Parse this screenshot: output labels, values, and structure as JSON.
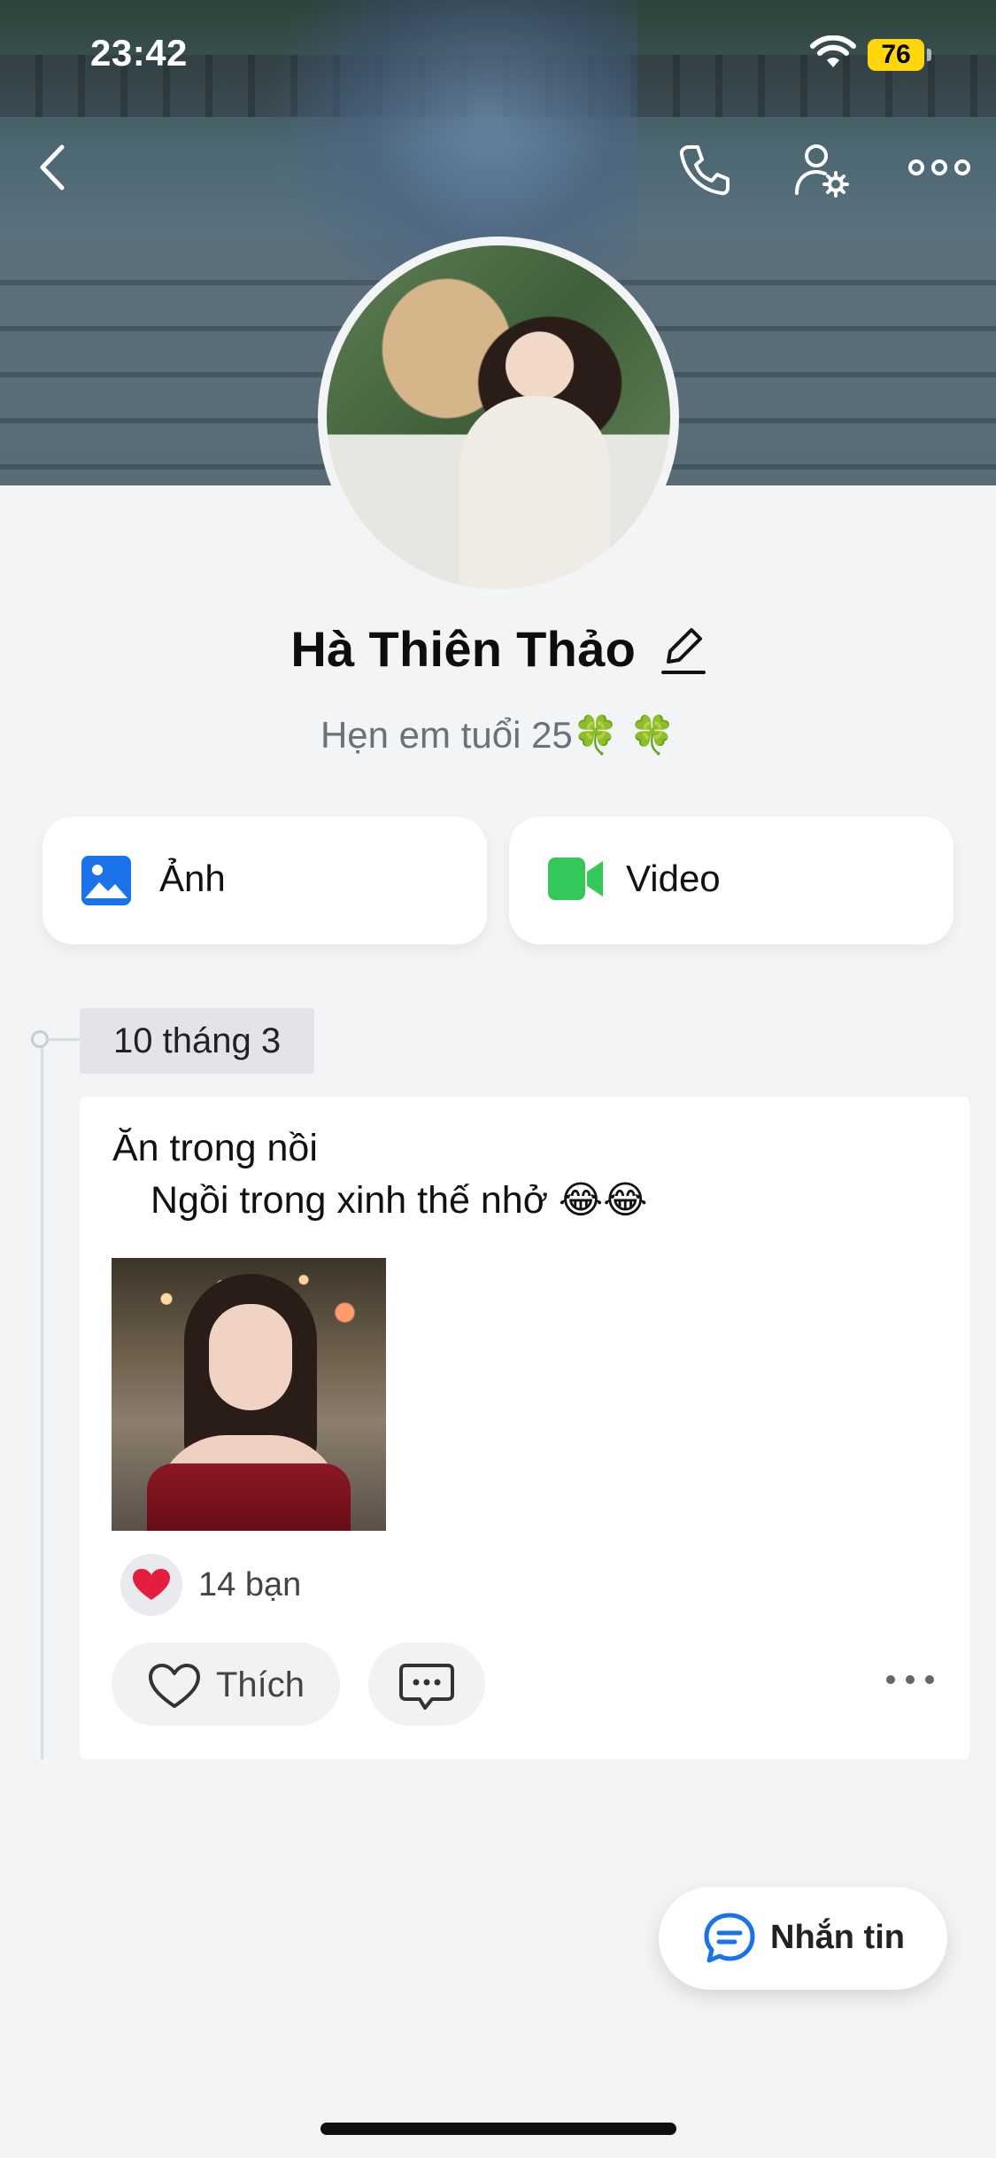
{
  "status_bar": {
    "time": "23:42",
    "battery": "76",
    "battery_color": "#ffd60a"
  },
  "top_bar": {
    "back_icon": "chevron-left-icon",
    "call_icon": "phone-icon",
    "settings_icon": "user-settings-icon",
    "more_icon": "more-horizontal-icon"
  },
  "profile": {
    "name": "Hà Thiên Thảo",
    "bio": "Hẹn em tuổi 25🍀 🍀",
    "edit_icon": "pencil-icon"
  },
  "media_cards": {
    "photos_label": "Ảnh",
    "videos_label": "Video",
    "photos_color": "#1a73e8",
    "videos_color": "#34c759"
  },
  "timeline": {
    "date": "10 tháng 3",
    "post": {
      "text_line1": "Ăn trong nồi",
      "text_line2": "Ngồi trong xinh thế nhở 😂😂",
      "reaction_emoji": "❤️",
      "reaction_count": "14 bạn",
      "like_label": "Thích"
    }
  },
  "fab": {
    "label": "Nhắn tin",
    "color": "#1a73e8"
  }
}
